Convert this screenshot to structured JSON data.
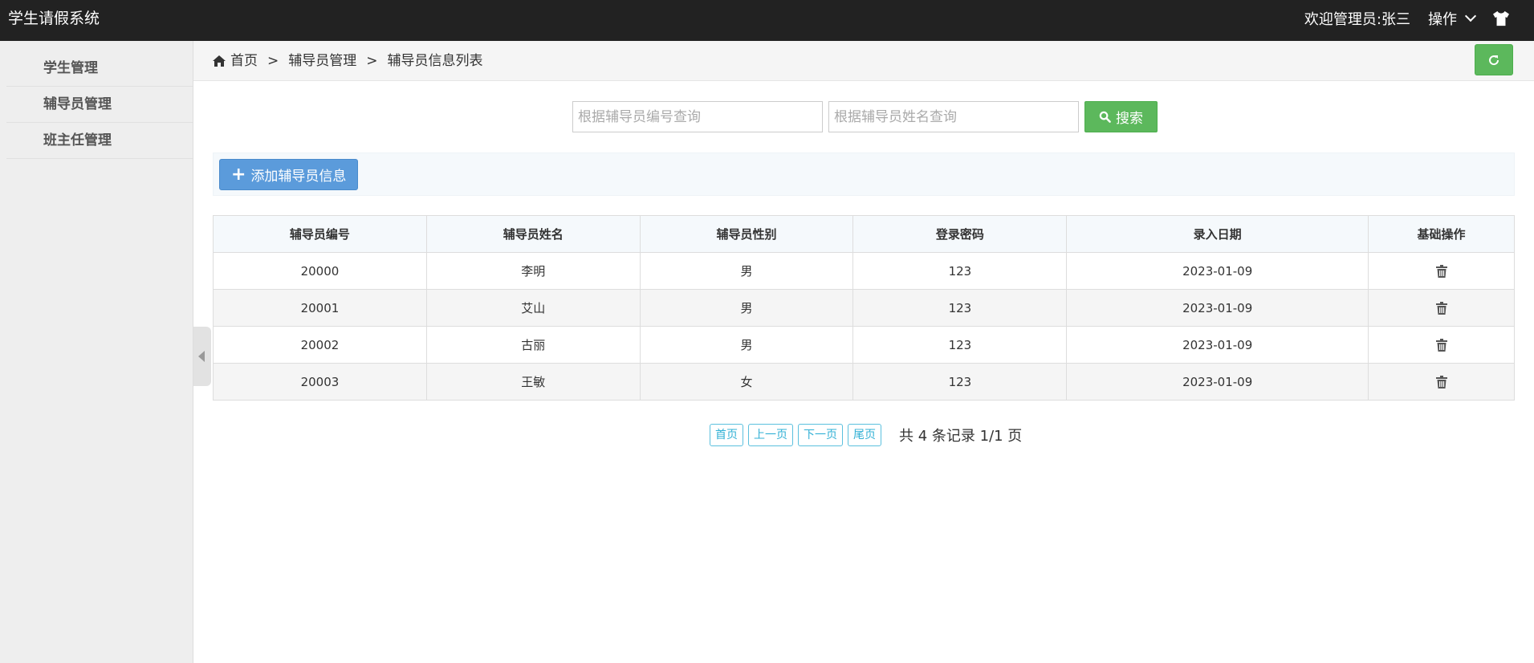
{
  "app": {
    "title": "学生请假系统"
  },
  "header": {
    "welcome": "欢迎管理员:张三",
    "operations_label": "操作"
  },
  "sidebar": {
    "items": [
      {
        "label": "学生管理"
      },
      {
        "label": "辅导员管理"
      },
      {
        "label": "班主任管理"
      }
    ]
  },
  "breadcrumb": {
    "home": "首页",
    "sep": ">",
    "level1": "辅导员管理",
    "level2": "辅导员信息列表"
  },
  "search": {
    "id_placeholder": "根据辅导员编号查询",
    "name_placeholder": "根据辅导员姓名查询",
    "button_label": "搜索"
  },
  "toolbar": {
    "add_label": "添加辅导员信息"
  },
  "table": {
    "headers": [
      "辅导员编号",
      "辅导员姓名",
      "辅导员性别",
      "登录密码",
      "录入日期",
      "基础操作"
    ],
    "rows": [
      {
        "id": "20000",
        "name": "李明",
        "gender": "男",
        "password": "123",
        "date": "2023-01-09"
      },
      {
        "id": "20001",
        "name": "艾山",
        "gender": "男",
        "password": "123",
        "date": "2023-01-09"
      },
      {
        "id": "20002",
        "name": "古丽",
        "gender": "男",
        "password": "123",
        "date": "2023-01-09"
      },
      {
        "id": "20003",
        "name": "王敏",
        "gender": "女",
        "password": "123",
        "date": "2023-01-09"
      }
    ]
  },
  "pagination": {
    "first": "首页",
    "prev": "上一页",
    "next": "下一页",
    "last": "尾页",
    "info": "共 4 条记录 1/1 页"
  },
  "colors": {
    "topbar": "#222222",
    "success": "#5cb85c",
    "primary": "#5b9bdb",
    "info": "#5bc0de"
  },
  "icons": {
    "shirt": "shirt-icon",
    "home": "home-icon",
    "refresh": "refresh-icon",
    "search": "search-icon",
    "plus": "plus-icon",
    "trash": "trash-icon",
    "chevron": "chevron-down-icon"
  }
}
